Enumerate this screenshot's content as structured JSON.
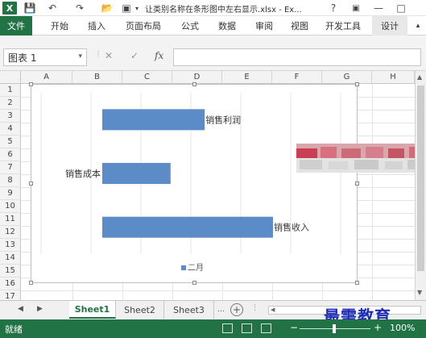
{
  "window": {
    "title": "让类别名称在条形图中左右显示.xlsx - Ex...",
    "app_icon": "X",
    "qat": [
      "save-icon",
      "undo-icon",
      "redo-icon",
      "open-icon",
      "print-preview-icon",
      "more-icon"
    ],
    "controls": [
      "?",
      "ribbon-display-icon",
      "minimize-icon",
      "maximize-icon"
    ]
  },
  "ribbon": {
    "tabs": [
      "文件",
      "开始",
      "插入",
      "页面布局",
      "公式",
      "数据",
      "审阅",
      "视图",
      "开发工具",
      "设计"
    ]
  },
  "formula_bar": {
    "name_box": "图表 1",
    "cancel": "✕",
    "enter": "✓",
    "fx": "fx",
    "value": ""
  },
  "grid": {
    "columns": [
      "A",
      "B",
      "C",
      "D",
      "E",
      "F",
      "G",
      "H"
    ],
    "rows": [
      "1",
      "2",
      "3",
      "4",
      "5",
      "6",
      "7",
      "8",
      "9",
      "10",
      "11",
      "12",
      "13",
      "14",
      "15",
      "16",
      "17"
    ]
  },
  "chart_data": {
    "type": "bar",
    "orientation": "horizontal",
    "categories": [
      "销售收入",
      "销售成本",
      "销售利润"
    ],
    "series": [
      {
        "name": "二月",
        "values": [
          100,
          40,
          60
        ],
        "color": "#5b8cc8"
      }
    ],
    "category_label_side": [
      "right",
      "left",
      "right"
    ],
    "legend_position": "bottom",
    "grid": true,
    "value_axis_visible": false
  },
  "sheets": {
    "tabs": [
      "Sheet1",
      "Sheet2",
      "Sheet3"
    ],
    "active": "Sheet1",
    "add_icon": "+"
  },
  "status": {
    "ready": "就绪",
    "zoom": "100%",
    "zoom_minus": "−",
    "zoom_plus": "+",
    "watermark": "最需教育"
  }
}
